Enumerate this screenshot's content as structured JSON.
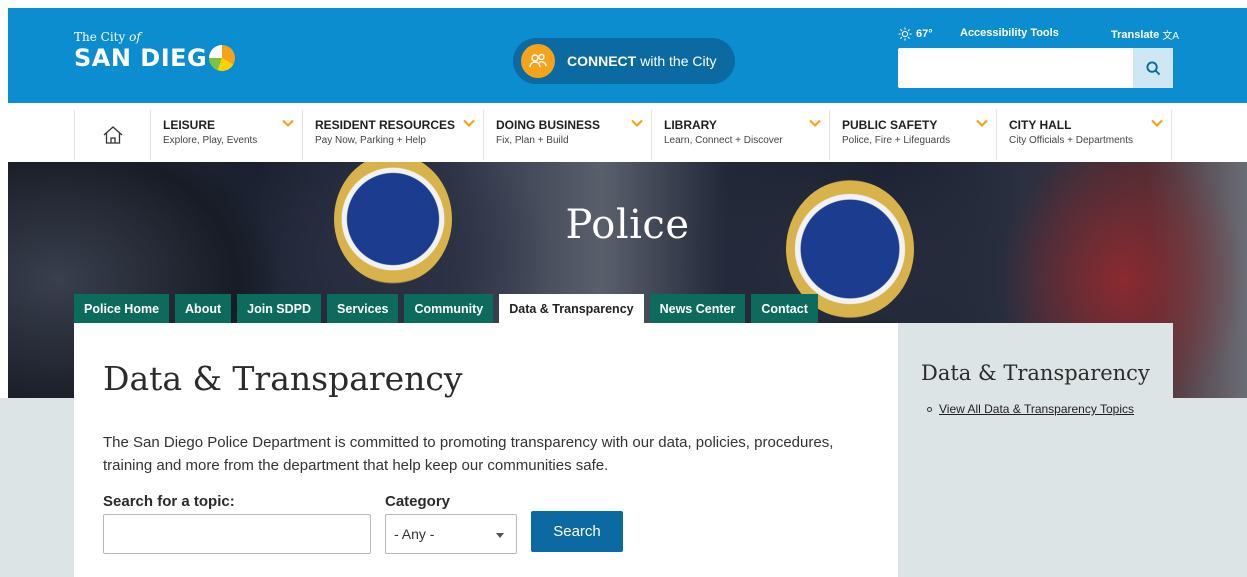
{
  "header": {
    "logo_small_1": "The City",
    "logo_small_2": "of",
    "logo_big": "SAN DIEG",
    "connect_bold": "CONNECT",
    "connect_rest": "with the City",
    "weather": "67°",
    "accessibility": "Accessibility Tools",
    "translate": "Translate",
    "translate_icon": "文A",
    "search_value": "",
    "icons": {
      "weather": "sun-icon",
      "search": "search-icon",
      "connect": "people-icon"
    }
  },
  "nav": {
    "home_icon": "home-icon",
    "items": [
      {
        "title": "LEISURE",
        "sub": "Explore, Play, Events"
      },
      {
        "title": "RESIDENT RESOURCES",
        "sub": "Pay Now, Parking + Help"
      },
      {
        "title": "DOING BUSINESS",
        "sub": "Fix, Plan + Build"
      },
      {
        "title": "LIBRARY",
        "sub": "Learn, Connect + Discover"
      },
      {
        "title": "PUBLIC SAFETY",
        "sub": "Police, Fire + Lifeguards"
      },
      {
        "title": "CITY HALL",
        "sub": "City Officials + Departments"
      }
    ]
  },
  "hero": {
    "title": "Police"
  },
  "tabs": [
    "Police Home",
    "About",
    "Join SDPD",
    "Services",
    "Community",
    "Data & Transparency",
    "News Center",
    "Contact"
  ],
  "active_tab": "Data & Transparency",
  "main": {
    "heading": "Data & Transparency",
    "intro": "The San Diego Police Department is committed to promoting transparency with our data, policies, procedures, training and more from the department that help keep our communities safe.",
    "search_label": "Search for a topic:",
    "search_value": "",
    "category_label": "Category",
    "category_selected": "- Any -",
    "search_button": "Search"
  },
  "sidebar": {
    "heading": "Data & Transparency",
    "links": [
      "View All Data & Transparency Topics"
    ]
  },
  "colors": {
    "header_blue": "#0c8dcf",
    "connect_blue": "#0a6aa1",
    "accent_orange": "#f7a21b",
    "tab_green": "#0d6b5d",
    "panel_gray": "#dde4e6"
  }
}
